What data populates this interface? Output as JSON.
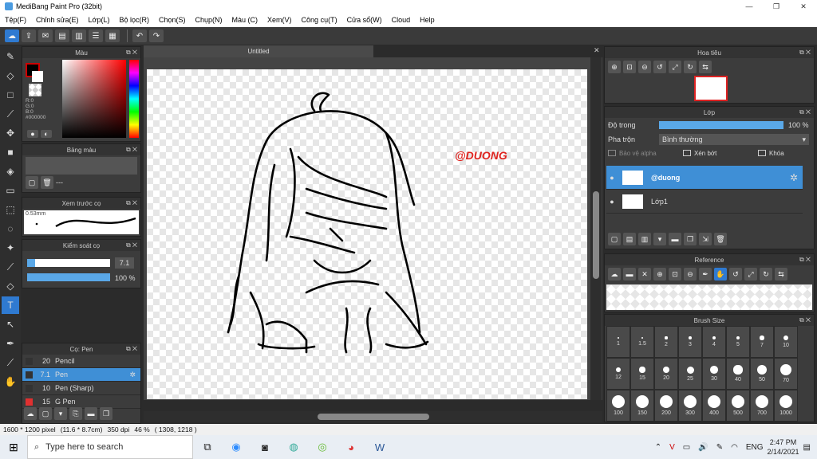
{
  "window": {
    "title": "MediBang Paint Pro (32bit)",
    "min": "—",
    "max": "❐",
    "close": "✕"
  },
  "menu": [
    "Tệp(F)",
    "Chỉnh sửa(E)",
    "Lớp(L)",
    "Bộ lọc(R)",
    "Chọn(S)",
    "Chụp(N)",
    "Màu (C)",
    "Xem(V)",
    "Công cụ(T)",
    "Cửa sổ(W)",
    "Cloud",
    "Help"
  ],
  "document": {
    "tab": "Untitled",
    "close": "✕",
    "watermark": "@DUONG"
  },
  "color_panel": {
    "title": "Màu",
    "r": "R:0",
    "g": "G:0",
    "b": "B:0",
    "hex": "#000000"
  },
  "palette_panel": {
    "title": "Bảng màu",
    "empty": "---"
  },
  "preview_panel": {
    "title": "Xem trước cọ",
    "size": "0.53mm"
  },
  "brush_control": {
    "title": "Kiểm soát cọ",
    "size_value": "7.1",
    "size_fill": 0.1,
    "opacity_value": "100 %",
    "opacity_fill": 1.0
  },
  "brush_panel": {
    "title": "Cọ: Pen",
    "items": [
      {
        "size": "20",
        "name": "Pencil",
        "color": "#333333"
      },
      {
        "size": "7.1",
        "name": "Pen",
        "color": "#333333",
        "selected": true
      },
      {
        "size": "10",
        "name": "Pen (Sharp)",
        "color": "#333333"
      },
      {
        "size": "15",
        "name": "G Pen",
        "color": "#e03030"
      }
    ]
  },
  "navigator": {
    "title": "Hoa tiêu"
  },
  "layer_panel": {
    "title": "Lớp",
    "opacity_label": "Độ trong",
    "opacity_value": "100 %",
    "opacity_fill": 1.0,
    "blend_label": "Pha trộn",
    "blend_value": "Bình thường",
    "protect_alpha": "Bảo vệ alpha",
    "clipping": "Xén bớt",
    "lock": "Khóa",
    "layers": [
      {
        "name": "@duong",
        "selected": true
      },
      {
        "name": "Lớp1",
        "selected": false
      }
    ]
  },
  "reference_panel": {
    "title": "Reference"
  },
  "brush_size_panel": {
    "title": "Brush Size",
    "sizes": [
      "1",
      "1.5",
      "2",
      "3",
      "4",
      "5",
      "7",
      "10",
      "12",
      "15",
      "20",
      "25",
      "30",
      "40",
      "50",
      "70",
      "100",
      "150",
      "200",
      "300",
      "400",
      "500",
      "700",
      "1000"
    ]
  },
  "status": {
    "dims": "1600 * 1200 pixel",
    "physical": "(11.6 * 8.7cm)",
    "dpi": "350 dpi",
    "zoom": "46 %",
    "coords": "( 1308, 1218 )"
  },
  "taskbar": {
    "search_placeholder": "Type here to search",
    "lang": "ENG",
    "time": "2:47 PM",
    "date": "2/14/2021"
  }
}
